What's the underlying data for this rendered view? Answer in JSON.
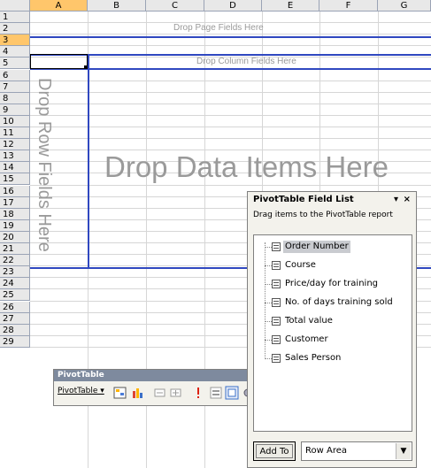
{
  "sheet": {
    "columns": [
      "A",
      "B",
      "C",
      "D",
      "E",
      "F",
      "G"
    ],
    "rows": [
      "1",
      "2",
      "3",
      "4",
      "5",
      "6",
      "7",
      "8",
      "9",
      "10",
      "11",
      "12",
      "13",
      "14",
      "15",
      "16",
      "17",
      "18",
      "19",
      "20",
      "21",
      "22",
      "23",
      "24",
      "25",
      "26",
      "27",
      "28",
      "29"
    ],
    "selected_column": "A",
    "selected_row": "3"
  },
  "pivot_area": {
    "page_fields_text": "Drop Page Fields Here",
    "column_fields_text": "Drop Column Fields Here",
    "row_fields_text": "Drop Row Fields Here",
    "data_items_text": "Drop Data Items Here"
  },
  "pivot_toolbar": {
    "title": "PivotTable",
    "menu_label": "PivotTable ▾",
    "close_glyph": "×",
    "dropdown_glyph": "▾"
  },
  "field_list": {
    "title": "PivotTable Field List",
    "subtitle": "Drag items to the PivotTable report",
    "close_glyph": "×",
    "dropdown_glyph": "▾",
    "fields": [
      "Order Number",
      "Course",
      "Price/day for training",
      "No. of days training sold",
      "Total value",
      "Customer",
      "Sales Person"
    ],
    "selected_field": "Order Number",
    "add_to_label": "Add To",
    "area_select_value": "Row Area"
  },
  "colors": {
    "pivot_border": "#3048c0",
    "selection_header": "#ffc66b",
    "toolbar_title": "#7e8a9e"
  }
}
